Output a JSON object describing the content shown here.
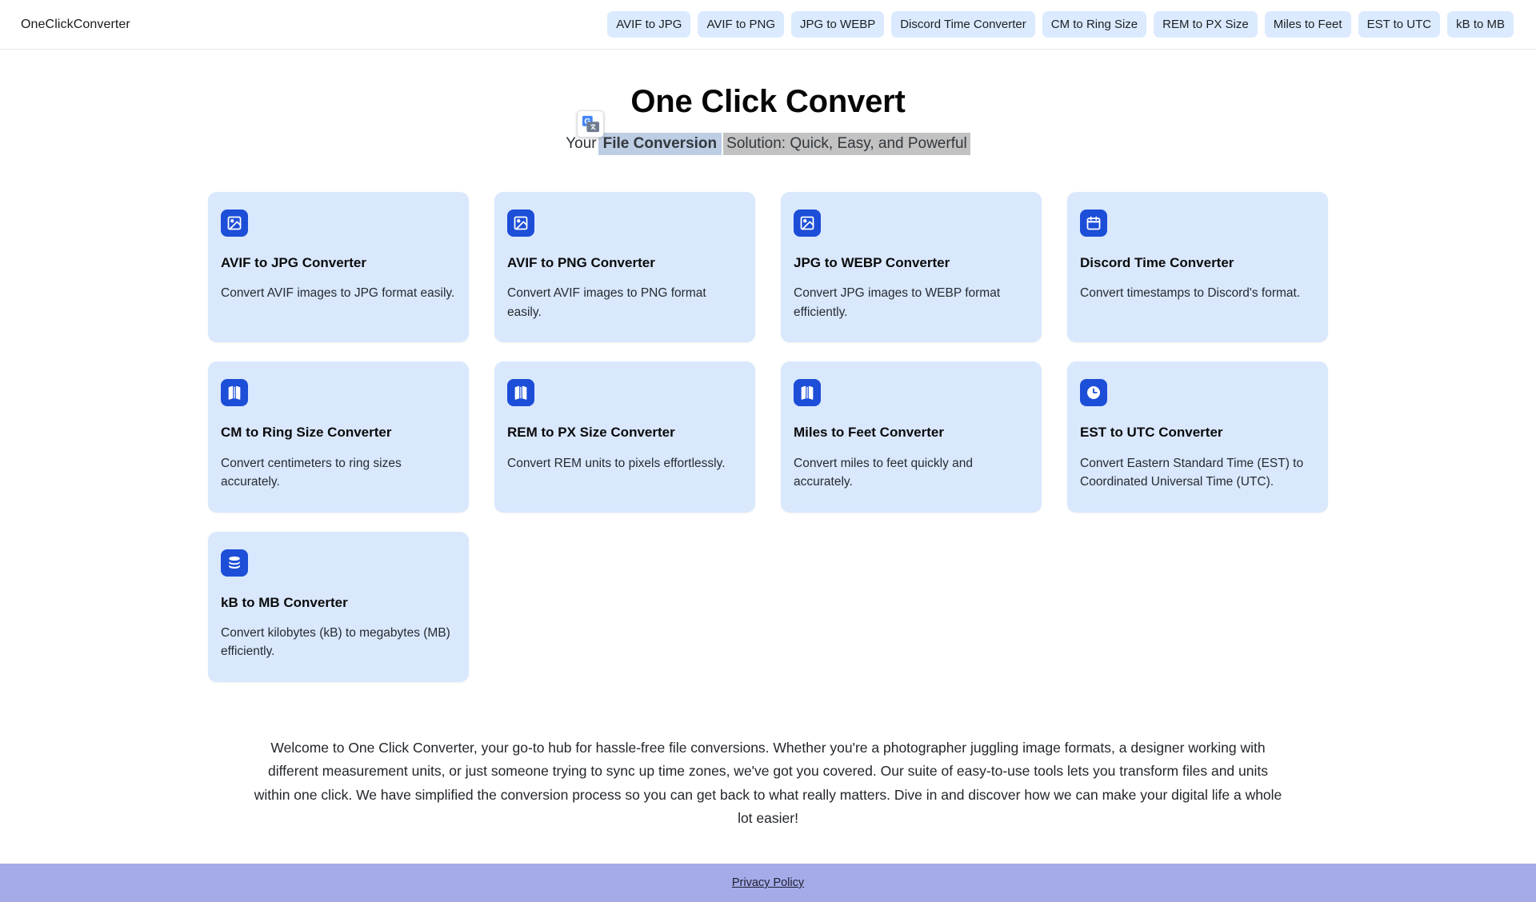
{
  "header": {
    "brand": "OneClickConverter",
    "nav_items": [
      {
        "label": "AVIF to JPG"
      },
      {
        "label": "AVIF to PNG"
      },
      {
        "label": "JPG to WEBP"
      },
      {
        "label": "Discord Time Converter"
      },
      {
        "label": "CM to Ring Size"
      },
      {
        "label": "REM to PX Size"
      },
      {
        "label": "Miles to Feet"
      },
      {
        "label": "EST to UTC"
      },
      {
        "label": "kB to MB"
      }
    ]
  },
  "hero": {
    "title": "One Click Convert",
    "subtitle_lead": "Your",
    "subtitle_bold": "File Conversion",
    "subtitle_rest": "Solution: Quick, Easy, and Powerful",
    "translate_icon": "google-translate-icon"
  },
  "cards": [
    {
      "icon": "image-icon",
      "title": "AVIF to JPG Converter",
      "desc": "Convert AVIF images to JPG format easily."
    },
    {
      "icon": "image-icon",
      "title": "AVIF to PNG Converter",
      "desc": "Convert AVIF images to PNG format easily."
    },
    {
      "icon": "image-icon",
      "title": "JPG to WEBP Converter",
      "desc": "Convert JPG images to WEBP format efficiently."
    },
    {
      "icon": "calendar-icon",
      "title": "Discord Time Converter",
      "desc": "Convert timestamps to Discord's format."
    },
    {
      "icon": "map-icon",
      "title": "CM to Ring Size Converter",
      "desc": "Convert centimeters to ring sizes accurately."
    },
    {
      "icon": "map-icon",
      "title": "REM to PX Size Converter",
      "desc": "Convert REM units to pixels effortlessly."
    },
    {
      "icon": "map-icon",
      "title": "Miles to Feet Converter",
      "desc": "Convert miles to feet quickly and accurately."
    },
    {
      "icon": "clock-icon",
      "title": "EST to UTC Converter",
      "desc": "Convert Eastern Standard Time (EST) to Coordinated Universal Time (UTC)."
    },
    {
      "icon": "database-icon",
      "title": "kB to MB Converter",
      "desc": "Convert kilobytes (kB) to megabytes (MB) efficiently."
    }
  ],
  "welcome": {
    "paragraph": "Welcome to One Click Converter, your go-to hub for hassle-free file conversions. Whether you're a photographer juggling image formats, a designer working with different measurement units, or just someone trying to sync up time zones, we've got you covered. Our suite of easy-to-use tools lets you transform files and units within one click. We have simplified the conversion process so you can get back to what really matters. Dive in and discover how we can make your digital life a whole lot easier!"
  },
  "footer": {
    "privacy_label": "Privacy Policy"
  },
  "colors": {
    "nav_pill_bg": "#dbeafe",
    "card_bg": "#d9e8fd",
    "icon_tile_bg": "#1c4ed8",
    "footer_bg": "#a5abe8",
    "selection_highlight": "#c2c2c2",
    "bold_highlight": "#bdcde4"
  }
}
